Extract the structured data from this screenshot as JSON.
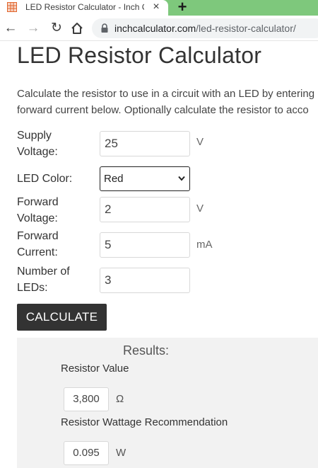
{
  "browser": {
    "tab_title": "LED Resistor Calculator - Inch Ca",
    "tab_close": "×",
    "new_tab": "+",
    "url_domain": "inchcalculator.com",
    "url_path": "/led-resistor-calculator/"
  },
  "page": {
    "title": "LED Resistor Calculator",
    "intro_line1": "Calculate the resistor to use in a circuit with an LED by entering",
    "intro_line2": "forward current below. Optionally calculate the resistor to acco"
  },
  "form": {
    "supply_voltage": {
      "label_line1": "Supply",
      "label_line2": "Voltage:",
      "value": "25",
      "unit": "V"
    },
    "led_color": {
      "label": "LED Color:",
      "selected": "Red"
    },
    "forward_voltage": {
      "label_line1": "Forward",
      "label_line2": "Voltage:",
      "value": "2",
      "unit": "V"
    },
    "forward_current": {
      "label_line1": "Forward",
      "label_line2": "Current:",
      "value": "5",
      "unit": "mA"
    },
    "num_leds": {
      "label_line1": "Number of",
      "label_line2": "LEDs:",
      "value": "3"
    },
    "calculate_label": "CALCULATE"
  },
  "results": {
    "title": "Results:",
    "resistor_value_label": "Resistor Value",
    "resistor_value": "3,800",
    "resistor_unit": "Ω",
    "wattage_label": "Resistor Wattage Recommendation",
    "wattage_value": "0.095",
    "wattage_unit": "W"
  },
  "colors": {
    "tab_strip": "#7ec87c",
    "button_bg": "#333333",
    "results_bg": "#f2f2f2"
  },
  "icons": [
    "calculator-favicon-icon",
    "close-icon",
    "new-tab-icon",
    "back-arrow-icon",
    "forward-arrow-icon",
    "reload-icon",
    "home-icon",
    "lock-icon",
    "chevron-down-icon"
  ]
}
